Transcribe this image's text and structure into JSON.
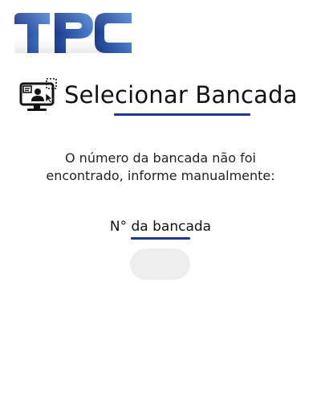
{
  "logo": {
    "text": "TPC",
    "color_start": "#1a3a8c",
    "color_end": "#4a7fd0"
  },
  "header": {
    "icon": "monitor-user-icon",
    "title": "Selecionar Bancada",
    "accent_color": "#1f3a8c"
  },
  "message": {
    "line1": "O número da bancada não foi",
    "line2": "encontrado, informe manualmente:"
  },
  "field": {
    "label": "N° da bancada",
    "value": "",
    "placeholder": ""
  }
}
